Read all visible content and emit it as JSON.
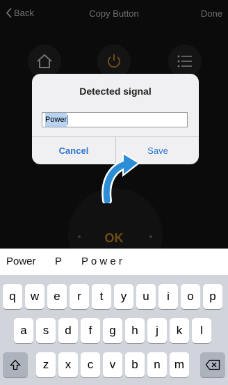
{
  "nav": {
    "back_label": "Back",
    "title": "Copy Button",
    "done_label": "Done"
  },
  "remote": {
    "home_icon": "home-icon",
    "power_icon": "power-icon",
    "menu_icon": "menu-icon",
    "ok_label": "OK",
    "accent": "#c68b2b"
  },
  "dialog": {
    "title": "Detected signal",
    "input_value": "Power",
    "cancel_label": "Cancel",
    "save_label": "Save",
    "button_color": "#2c76cf"
  },
  "suggestions": [
    "Power",
    "P",
    "P o w e r"
  ],
  "keyboard": {
    "row1": [
      "q",
      "w",
      "e",
      "r",
      "t",
      "y",
      "u",
      "i",
      "o",
      "p"
    ],
    "row2": [
      "a",
      "s",
      "d",
      "f",
      "g",
      "h",
      "j",
      "k",
      "l"
    ],
    "row3": [
      "z",
      "x",
      "c",
      "v",
      "b",
      "n",
      "m"
    ],
    "shift_icon": "shift-icon",
    "delete_icon": "delete-icon"
  }
}
